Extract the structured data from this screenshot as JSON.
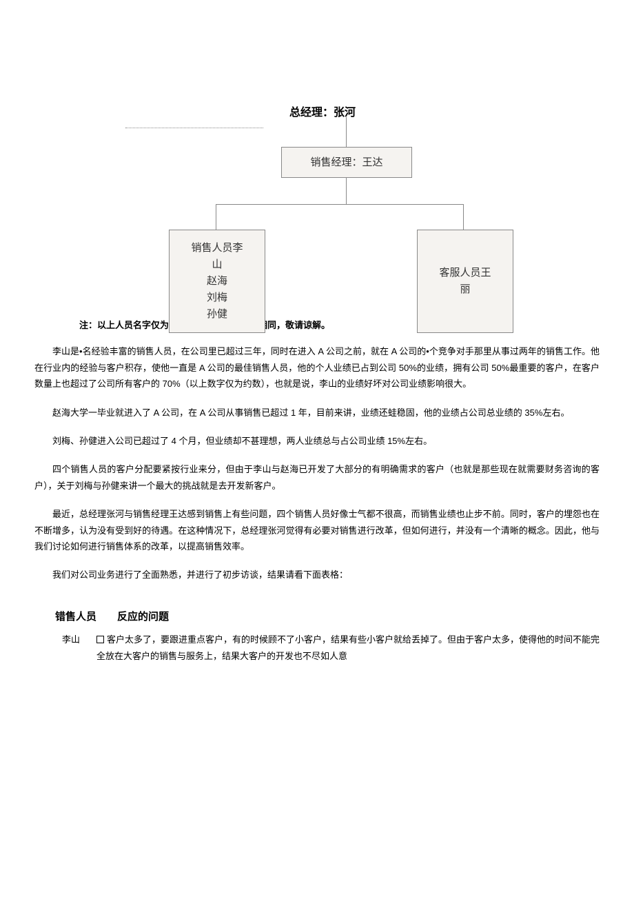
{
  "org": {
    "title": "总经理：张河",
    "manager": "销售经理：王达",
    "sales": {
      "header": "销售人员李",
      "names": [
        "山",
        "赵海",
        "刘梅",
        "孙健"
      ]
    },
    "service": {
      "header": "客服人员王",
      "name": "丽"
    }
  },
  "note": "注：以上人员名字仅为说明方便而假设，如有相同，敬请谅解。",
  "paragraphs": [
    "李山是•名经验丰富的销售人员，在公司里已超过三年，同时在进入 A 公司之前，就在 A 公司的•个竞争对手那里从事过两年的销售工作。他在行业内的经验与客户积存，使他一直是 A 公司的最佳销售人员，他的个人业绩已占到公司 50%的业绩，拥有公司 50%最重要的客户，在客户数量上也超过了公司所有客户的 70%（以上数字仅为约数），也就是说，李山的业绩好坏对公司业绩影响很大。",
    "赵海大学一毕业就进入了 A 公司，在 A 公司从事销售已超过 1 年，目前来讲，业绩还蛙稳固，他的业绩占公司总业绩的 35%左右。",
    "刘梅、孙健进入公司已超过了 4 个月，但业绩却不甚理想，两人业绩总与占公司业绩 15%左右。",
    "四个销售人员的客户分配要紧按行业来分，但由于李山与赵海已开发了大部分的有明确需求的客户（也就是那些现在就需要财务咨询的客户），关于刘梅与孙健来讲一个最大的挑战就是去开发新客户。",
    "最近，总经理张河与销售经理王达感到销售上有些问题，四个销售人员好像士气都不很高，而销售业绩也止步不前。同时，客户的埋怨也在不断增多，认为没有受到好的待遇。在这种情况下，总经理张河觉得有必要对销售进行改革，但如何进行，并没有一个清晰的概念。因此，他与我们讨论如何进行销售体系的改革，以提高销售效率。",
    "我们对公司业务进行了全面熟悉，并进行了初步访谈，结果请看下面表格："
  ],
  "table": {
    "headers": {
      "person": "错售人员",
      "problem": "反应的问题"
    },
    "rows": [
      {
        "person": "李山",
        "content": "客户太多了，要跟进重点客户，有的时候顾不了小客户，结果有些小客户就给丢掉了。但由于客户太多，使得他的时间不能完全放在大客户的销售与服务上，结果大客户的开发也不尽如人意"
      }
    ]
  }
}
